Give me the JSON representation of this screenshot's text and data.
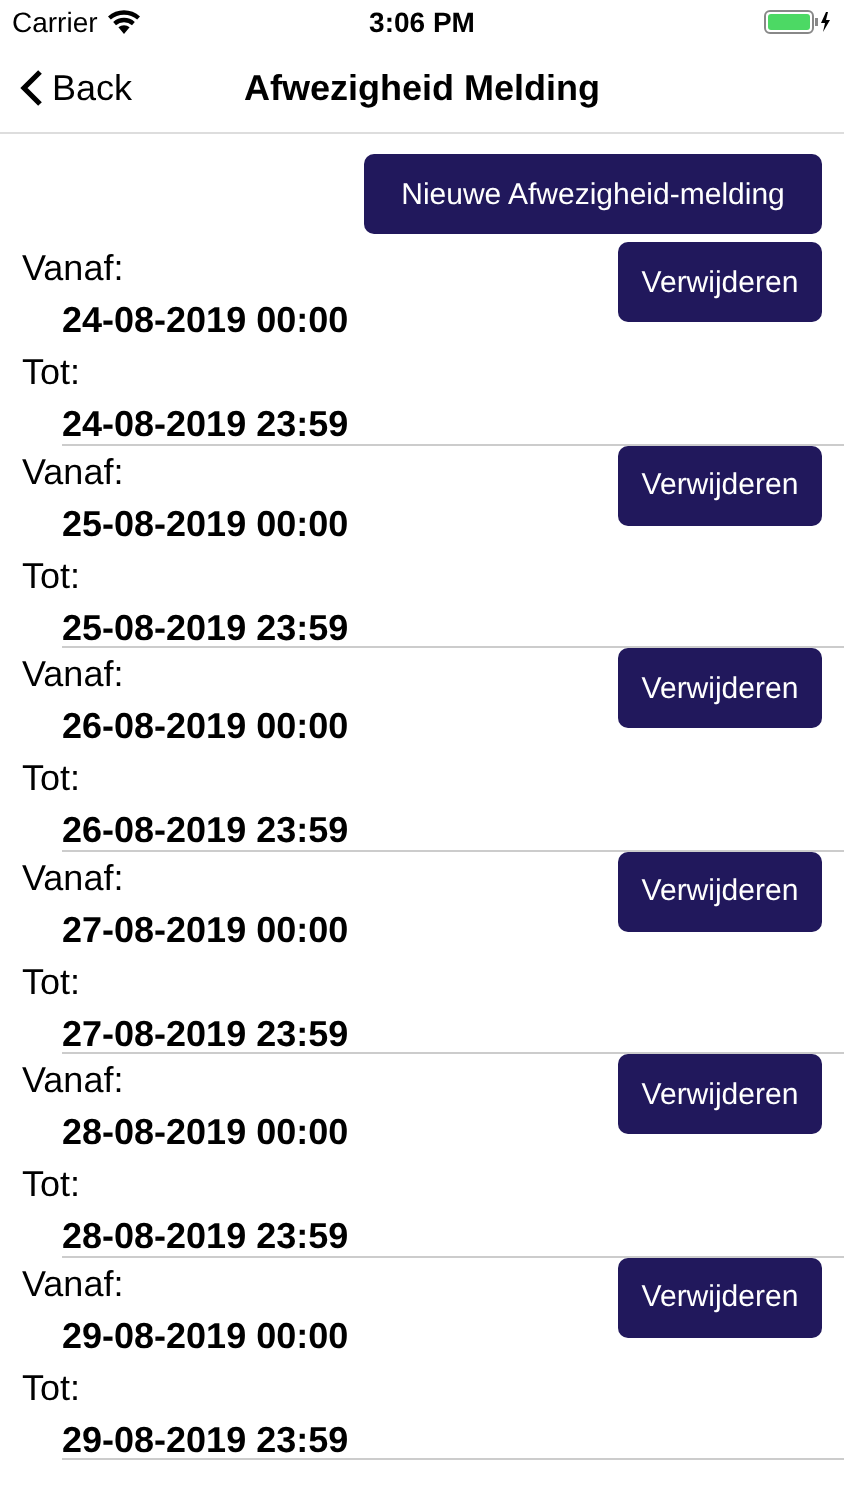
{
  "status_bar": {
    "carrier": "Carrier",
    "time": "3:06 PM"
  },
  "nav": {
    "back": "Back",
    "title": "Afwezigheid Melding"
  },
  "new_button": "Nieuwe Afwezigheid-melding",
  "entries": [
    {
      "from_label": "Vanaf:",
      "from": "24-08-2019 00:00",
      "to_label": "Tot:",
      "to": "24-08-2019 23:59",
      "button": "Verwijderen"
    },
    {
      "from_label": "Vanaf:",
      "from": "25-08-2019 00:00",
      "to_label": "Tot:",
      "to": "25-08-2019 23:59",
      "button": "Verwijderen"
    },
    {
      "from_label": "Vanaf:",
      "from": "26-08-2019 00:00",
      "to_label": "Tot:",
      "to": "26-08-2019 23:59",
      "button": "Verwijderen"
    },
    {
      "from_label": "Vanaf:",
      "from": "27-08-2019 00:00",
      "to_label": "Tot:",
      "to": "27-08-2019 23:59",
      "button": "Verwijderen"
    },
    {
      "from_label": "Vanaf:",
      "from": "28-08-2019 00:00",
      "to_label": "Tot:",
      "to": "28-08-2019 23:59",
      "button": "Verwijderen"
    },
    {
      "from_label": "Vanaf:",
      "from": "29-08-2019 00:00",
      "to_label": "Tot:",
      "to": "29-08-2019 23:59",
      "button": "Verwijderen"
    }
  ]
}
